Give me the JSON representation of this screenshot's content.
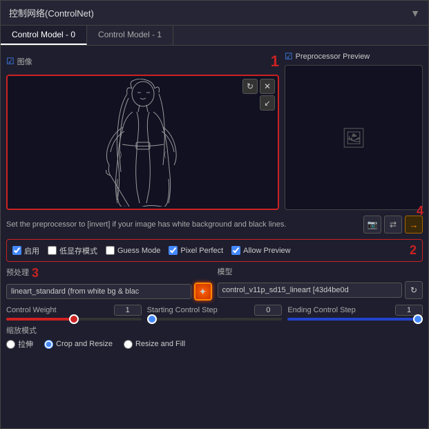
{
  "panel": {
    "title": "控制网络(ControlNet)",
    "arrow": "▼"
  },
  "tabs": [
    {
      "label": "Control Model - 0",
      "active": true
    },
    {
      "label": "Control Model - 1",
      "active": false
    }
  ],
  "image_section": {
    "label": "图像",
    "checkbox_icon": "☑",
    "number_badge": "1"
  },
  "preprocessor_preview": {
    "label": "Preprocessor Preview",
    "checkbox_icon": "☑",
    "image_icon": "🖼"
  },
  "hint": {
    "text": "Set the preprocessor to [invert] if your image has white background and black lines.",
    "camera_icon": "📷",
    "swap_icon": "⇄",
    "send_icon": "→"
  },
  "checkboxes": {
    "enable": {
      "label": "启用",
      "checked": true
    },
    "low_vram": {
      "label": "低显存模式",
      "checked": false
    },
    "guess_mode": {
      "label": "Guess Mode",
      "checked": false
    },
    "pixel_perfect": {
      "label": "Pixel Perfect",
      "checked": true
    },
    "allow_preview": {
      "label": "Allow Preview",
      "checked": true
    },
    "number_badge": "2"
  },
  "preprocessor": {
    "section_label": "预处理",
    "value": "lineart_standard (from white bg & blac",
    "number_badge": "3"
  },
  "model": {
    "section_label": "模型",
    "value": "control_v11p_sd15_lineart [43d4be0d"
  },
  "sliders": {
    "control_weight": {
      "label": "Control Weight",
      "value": "1",
      "min": 0,
      "max": 2,
      "current": 50
    },
    "starting_step": {
      "label": "Starting Control Step",
      "value": "0",
      "min": 0,
      "max": 1,
      "current": 0
    },
    "ending_step": {
      "label": "Ending Control Step",
      "value": "1",
      "min": 0,
      "max": 1,
      "current": 100
    }
  },
  "zoom_mode": {
    "label": "缩放模式",
    "options": [
      {
        "label": "拉伸",
        "value": "stretch",
        "selected": false
      },
      {
        "label": "Crop and Resize",
        "value": "crop",
        "selected": true
      },
      {
        "label": "Resize and Fill",
        "value": "fill",
        "selected": false
      }
    ],
    "number_badge": "4"
  },
  "icons": {
    "run": "✦",
    "refresh": "↻",
    "camera": "📷",
    "swap": "⇄",
    "arrow_right": "→",
    "image_placeholder": "🖼"
  }
}
